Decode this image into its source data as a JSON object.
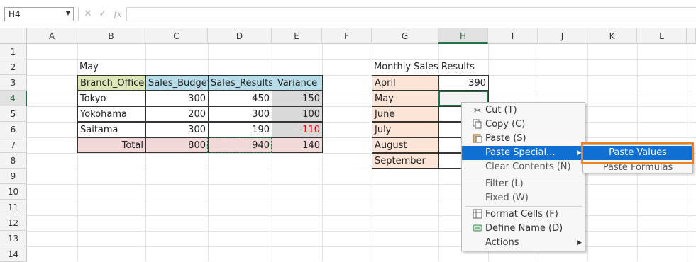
{
  "formula_bar": {
    "name_box": "H4",
    "name_box_arrow": "▼",
    "cancel_icon": "✕",
    "enter_icon": "✓",
    "fx_label": "fx",
    "formula_value": ""
  },
  "columns": [
    "A",
    "B",
    "C",
    "D",
    "E",
    "F",
    "G",
    "H",
    "I",
    "J",
    "K",
    "L"
  ],
  "selected_column": "H",
  "rows": [
    "1",
    "2",
    "3",
    "4",
    "5",
    "6",
    "7",
    "8",
    "9",
    "10",
    "11",
    "12",
    "13",
    "14"
  ],
  "selected_row": "4",
  "table1": {
    "title": "May",
    "headers": [
      "Branch_Office",
      "Sales_Budget",
      "Sales_Results",
      "Variance"
    ],
    "rows": [
      [
        "Tokyo",
        "300",
        "450",
        "150"
      ],
      [
        "Yokohama",
        "200",
        "300",
        "100"
      ],
      [
        "Saitama",
        "300",
        "190",
        "-110"
      ]
    ],
    "total": [
      "Total",
      "800",
      "940",
      "140"
    ]
  },
  "table2": {
    "title": "Monthly Sales Results",
    "months": [
      "April",
      "May",
      "June",
      "July",
      "August",
      "September"
    ],
    "values": [
      "390",
      "",
      "",
      "",
      "",
      ""
    ]
  },
  "context_menu": {
    "items": [
      {
        "label": "Cut (T)",
        "icon": "scissors-icon"
      },
      {
        "label": "Copy (C)",
        "icon": "copy-icon"
      },
      {
        "label": "Paste (S)",
        "icon": "paste-icon"
      },
      {
        "label": "Paste Special...",
        "icon": ""
      },
      {
        "label": "Clear Contents (N)",
        "icon": ""
      },
      {
        "label": "Filter (L)",
        "icon": ""
      },
      {
        "label": "Fixed (W)",
        "icon": ""
      },
      {
        "label": "Format Cells (F)",
        "icon": "format-cells-icon"
      },
      {
        "label": "Define Name (D)",
        "icon": "define-name-icon"
      },
      {
        "label": "Actions",
        "icon": ""
      }
    ],
    "submenu_arrow": "▶"
  },
  "submenu": {
    "items": [
      "Paste Values",
      "Paste Formulas"
    ]
  },
  "colors": {
    "selection_green": "#217346",
    "menu_highlight": "#0f6fd3",
    "callout_orange": "#f07f20",
    "negative_red": "#e00000"
  }
}
